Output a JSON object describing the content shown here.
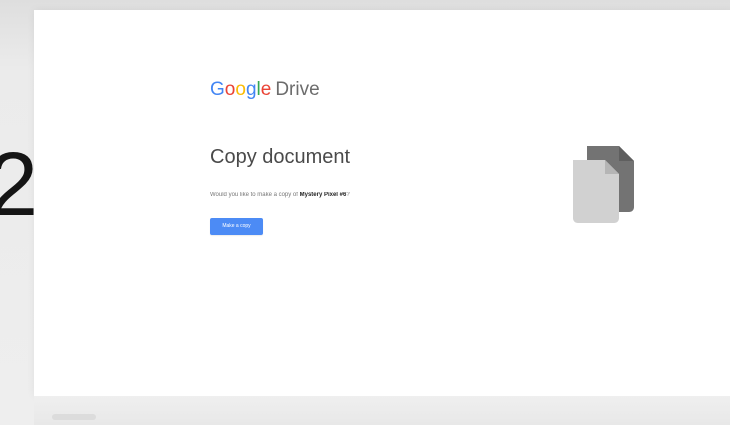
{
  "slide": {
    "step_number": "2"
  },
  "header": {
    "logo_google": "Google",
    "logo_product": "Drive",
    "logo_letters": [
      "G",
      "o",
      "o",
      "g",
      "l",
      "e"
    ]
  },
  "dialog": {
    "title": "Copy document",
    "prompt_prefix": "Would you like to make a copy of",
    "document_name": "Mystery Pixel #6",
    "prompt_suffix": "?",
    "button_label": "Make a copy"
  },
  "icons": {
    "document_copy": "document-copy-icon"
  },
  "colors": {
    "google_blue": "#4285F4",
    "google_red": "#EA4335",
    "google_yellow": "#FBBC05",
    "google_green": "#34A853",
    "button_blue": "#4C8BF5"
  }
}
